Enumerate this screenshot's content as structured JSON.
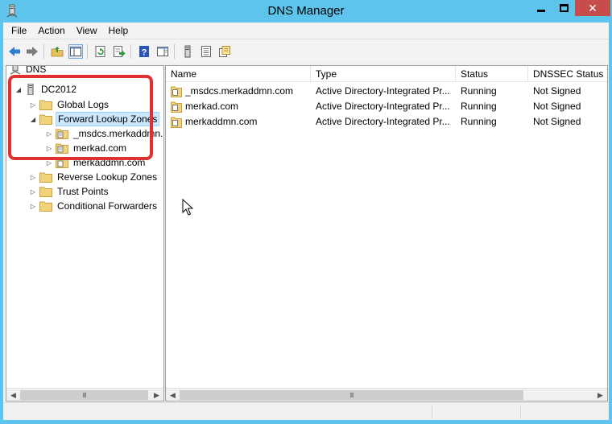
{
  "window": {
    "title": "DNS Manager",
    "close_glyph": "✕"
  },
  "menu": [
    "File",
    "Action",
    "View",
    "Help"
  ],
  "toolbar": {
    "icons": [
      "back-arrow-icon",
      "forward-arrow-icon",
      "up-folder-icon",
      "show-hide-console-tree-icon",
      "refresh-icon",
      "export-list-icon",
      "help-icon",
      "action-pane-icon",
      "server-icon",
      "list-icon",
      "properties-icon"
    ]
  },
  "tree": {
    "root": "DNS",
    "server": "DC2012",
    "global_logs": "Global Logs",
    "forward_zones": "Forward Lookup Zones",
    "zone_1": "_msdcs.merkaddmn.com",
    "zone_2": "merkad.com",
    "zone_3": "merkaddmn.com",
    "reverse_zones": "Reverse Lookup Zones",
    "trust_points": "Trust Points",
    "conditional_forwarders": "Conditional Forwarders"
  },
  "list": {
    "columns": [
      "Name",
      "Type",
      "Status",
      "DNSSEC Status"
    ],
    "rows": [
      {
        "name": "_msdcs.merkaddmn.com",
        "type": "Active Directory-Integrated Pr...",
        "status": "Running",
        "dnssec": "Not Signed"
      },
      {
        "name": "merkad.com",
        "type": "Active Directory-Integrated Pr...",
        "status": "Running",
        "dnssec": "Not Signed"
      },
      {
        "name": "merkaddmn.com",
        "type": "Active Directory-Integrated Pr...",
        "status": "Running",
        "dnssec": "Not Signed"
      }
    ]
  },
  "scroll_glyphs": {
    "left": "◀",
    "right": "▶",
    "thumb": "III"
  },
  "colors": {
    "titlebar": "#5fc4ec",
    "close_button": "#c74d4d",
    "highlight_box": "#e03131",
    "selection": "#cce8ff"
  }
}
